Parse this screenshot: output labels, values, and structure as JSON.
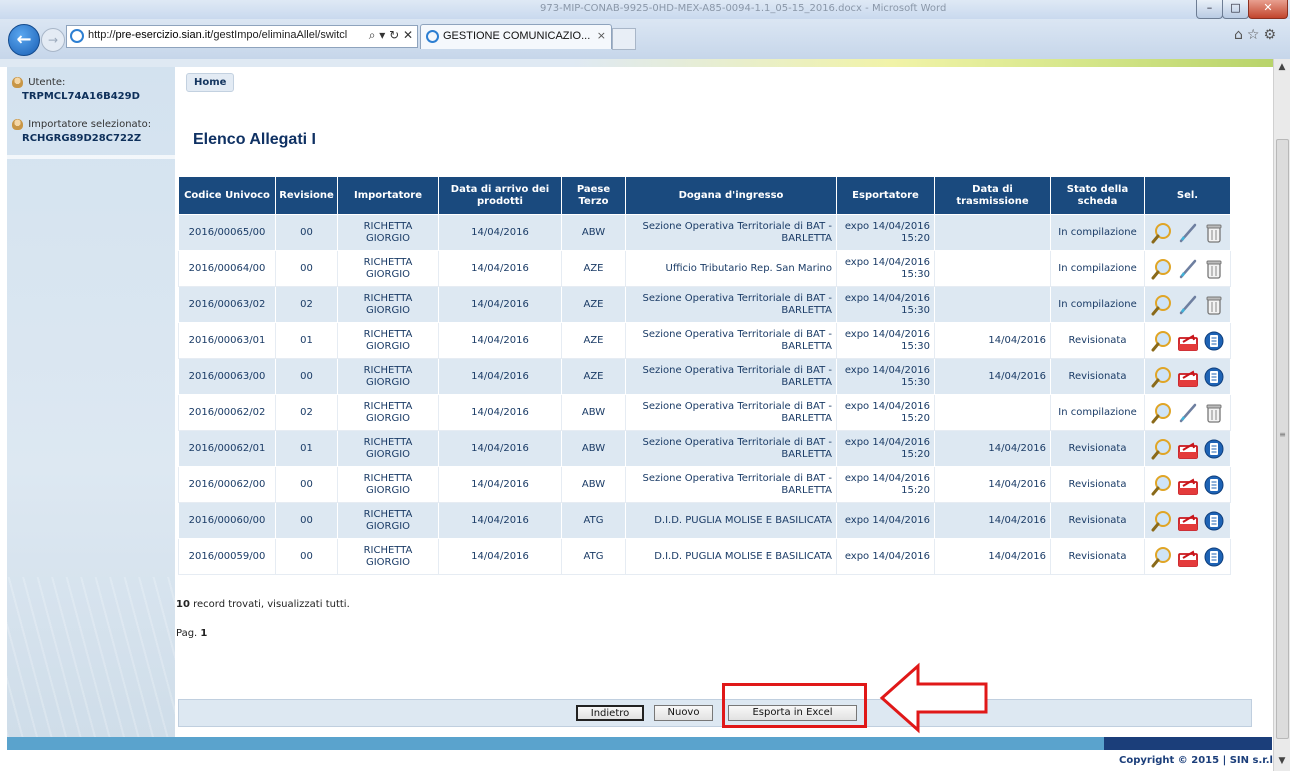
{
  "browser": {
    "window_title": "973-MIP-CONAB-9925-0HD-MEX-A85-0094-1.1_05-15_2016.docx - Microsoft Word",
    "url_prefix": "http://",
    "url_host": "pre-esercizio.sian.it",
    "url_path": "/gestImpo/eliminaAllel/switcl",
    "address_controls": "⌕ ▾ ↻ ✕",
    "tab_title": "GESTIONE COMUNICAZIO...",
    "tab_close": "×",
    "toolbar_icons": "⌂☆⚙",
    "win_min": "–",
    "win_max": "□",
    "win_close": "✕"
  },
  "sidebar": {
    "user_label": "Utente:",
    "user_value": "TRPMCL74A16B429D",
    "importer_label": "Importatore selezionato:",
    "importer_value": "RCHGRG89D28C722Z"
  },
  "main": {
    "home": "Home",
    "title": "Elenco Allegati I"
  },
  "table": {
    "headers": [
      "Codice Univoco",
      "Revisione",
      "Importatore",
      "Data di arrivo dei prodotti",
      "Paese Terzo",
      "Dogana d'ingresso",
      "Esportatore",
      "Data di trasmissione",
      "Stato della scheda",
      "Sel."
    ],
    "rows": [
      {
        "codice": "2016/00065/00",
        "rev": "00",
        "imp": "RICHETTA GIORGIO",
        "arrivo": "14/04/2016",
        "paese": "ABW",
        "dogana": "Sezione Operativa Territoriale di BAT - BARLETTA",
        "esp": "expo 14/04/2016 15:20",
        "trasm": "",
        "stato": "In compilazione",
        "actions": "edit"
      },
      {
        "codice": "2016/00064/00",
        "rev": "00",
        "imp": "RICHETTA GIORGIO",
        "arrivo": "14/04/2016",
        "paese": "AZE",
        "dogana": "Ufficio Tributario Rep. San Marino",
        "esp": "expo 14/04/2016 15:30",
        "trasm": "",
        "stato": "In compilazione",
        "actions": "edit"
      },
      {
        "codice": "2016/00063/02",
        "rev": "02",
        "imp": "RICHETTA GIORGIO",
        "arrivo": "14/04/2016",
        "paese": "AZE",
        "dogana": "Sezione Operativa Territoriale di BAT - BARLETTA",
        "esp": "expo 14/04/2016 15:30",
        "trasm": "",
        "stato": "In compilazione",
        "actions": "edit"
      },
      {
        "codice": "2016/00063/01",
        "rev": "01",
        "imp": "RICHETTA GIORGIO",
        "arrivo": "14/04/2016",
        "paese": "AZE",
        "dogana": "Sezione Operativa Territoriale di BAT - BARLETTA",
        "esp": "expo 14/04/2016 15:30",
        "trasm": "14/04/2016",
        "stato": "Revisionata",
        "actions": "view"
      },
      {
        "codice": "2016/00063/00",
        "rev": "00",
        "imp": "RICHETTA GIORGIO",
        "arrivo": "14/04/2016",
        "paese": "AZE",
        "dogana": "Sezione Operativa Territoriale di BAT - BARLETTA",
        "esp": "expo 14/04/2016 15:30",
        "trasm": "14/04/2016",
        "stato": "Revisionata",
        "actions": "view"
      },
      {
        "codice": "2016/00062/02",
        "rev": "02",
        "imp": "RICHETTA GIORGIO",
        "arrivo": "14/04/2016",
        "paese": "ABW",
        "dogana": "Sezione Operativa Territoriale di BAT - BARLETTA",
        "esp": "expo 14/04/2016 15:20",
        "trasm": "",
        "stato": "In compilazione",
        "actions": "edit"
      },
      {
        "codice": "2016/00062/01",
        "rev": "01",
        "imp": "RICHETTA GIORGIO",
        "arrivo": "14/04/2016",
        "paese": "ABW",
        "dogana": "Sezione Operativa Territoriale di BAT - BARLETTA",
        "esp": "expo 14/04/2016 15:20",
        "trasm": "14/04/2016",
        "stato": "Revisionata",
        "actions": "view"
      },
      {
        "codice": "2016/00062/00",
        "rev": "00",
        "imp": "RICHETTA GIORGIO",
        "arrivo": "14/04/2016",
        "paese": "ABW",
        "dogana": "Sezione Operativa Territoriale di BAT - BARLETTA",
        "esp": "expo 14/04/2016 15:20",
        "trasm": "14/04/2016",
        "stato": "Revisionata",
        "actions": "view"
      },
      {
        "codice": "2016/00060/00",
        "rev": "00",
        "imp": "RICHETTA GIORGIO",
        "arrivo": "14/04/2016",
        "paese": "ATG",
        "dogana": "D.I.D. PUGLIA MOLISE E BASILICATA",
        "esp": "expo 14/04/2016",
        "trasm": "14/04/2016",
        "stato": "Revisionata",
        "actions": "view"
      },
      {
        "codice": "2016/00059/00",
        "rev": "00",
        "imp": "RICHETTA GIORGIO",
        "arrivo": "14/04/2016",
        "paese": "ATG",
        "dogana": "D.I.D. PUGLIA MOLISE E BASILICATA",
        "esp": "expo 14/04/2016",
        "trasm": "14/04/2016",
        "stato": "Revisionata",
        "actions": "view"
      }
    ]
  },
  "summary": {
    "count": "10",
    "count_text": " record trovati, visualizzati tutti.",
    "page_label": "Pag. ",
    "page_number": "1"
  },
  "buttons": {
    "back": "Indietro",
    "new": "Nuovo",
    "export": "Esporta in Excel"
  },
  "footer": {
    "copyright": "Copyright © 2015 | SIN s.r.l."
  },
  "colors": {
    "header_bg": "#1a4a7e",
    "row_alt": "#dde8f2",
    "annotation": "#e01818"
  }
}
